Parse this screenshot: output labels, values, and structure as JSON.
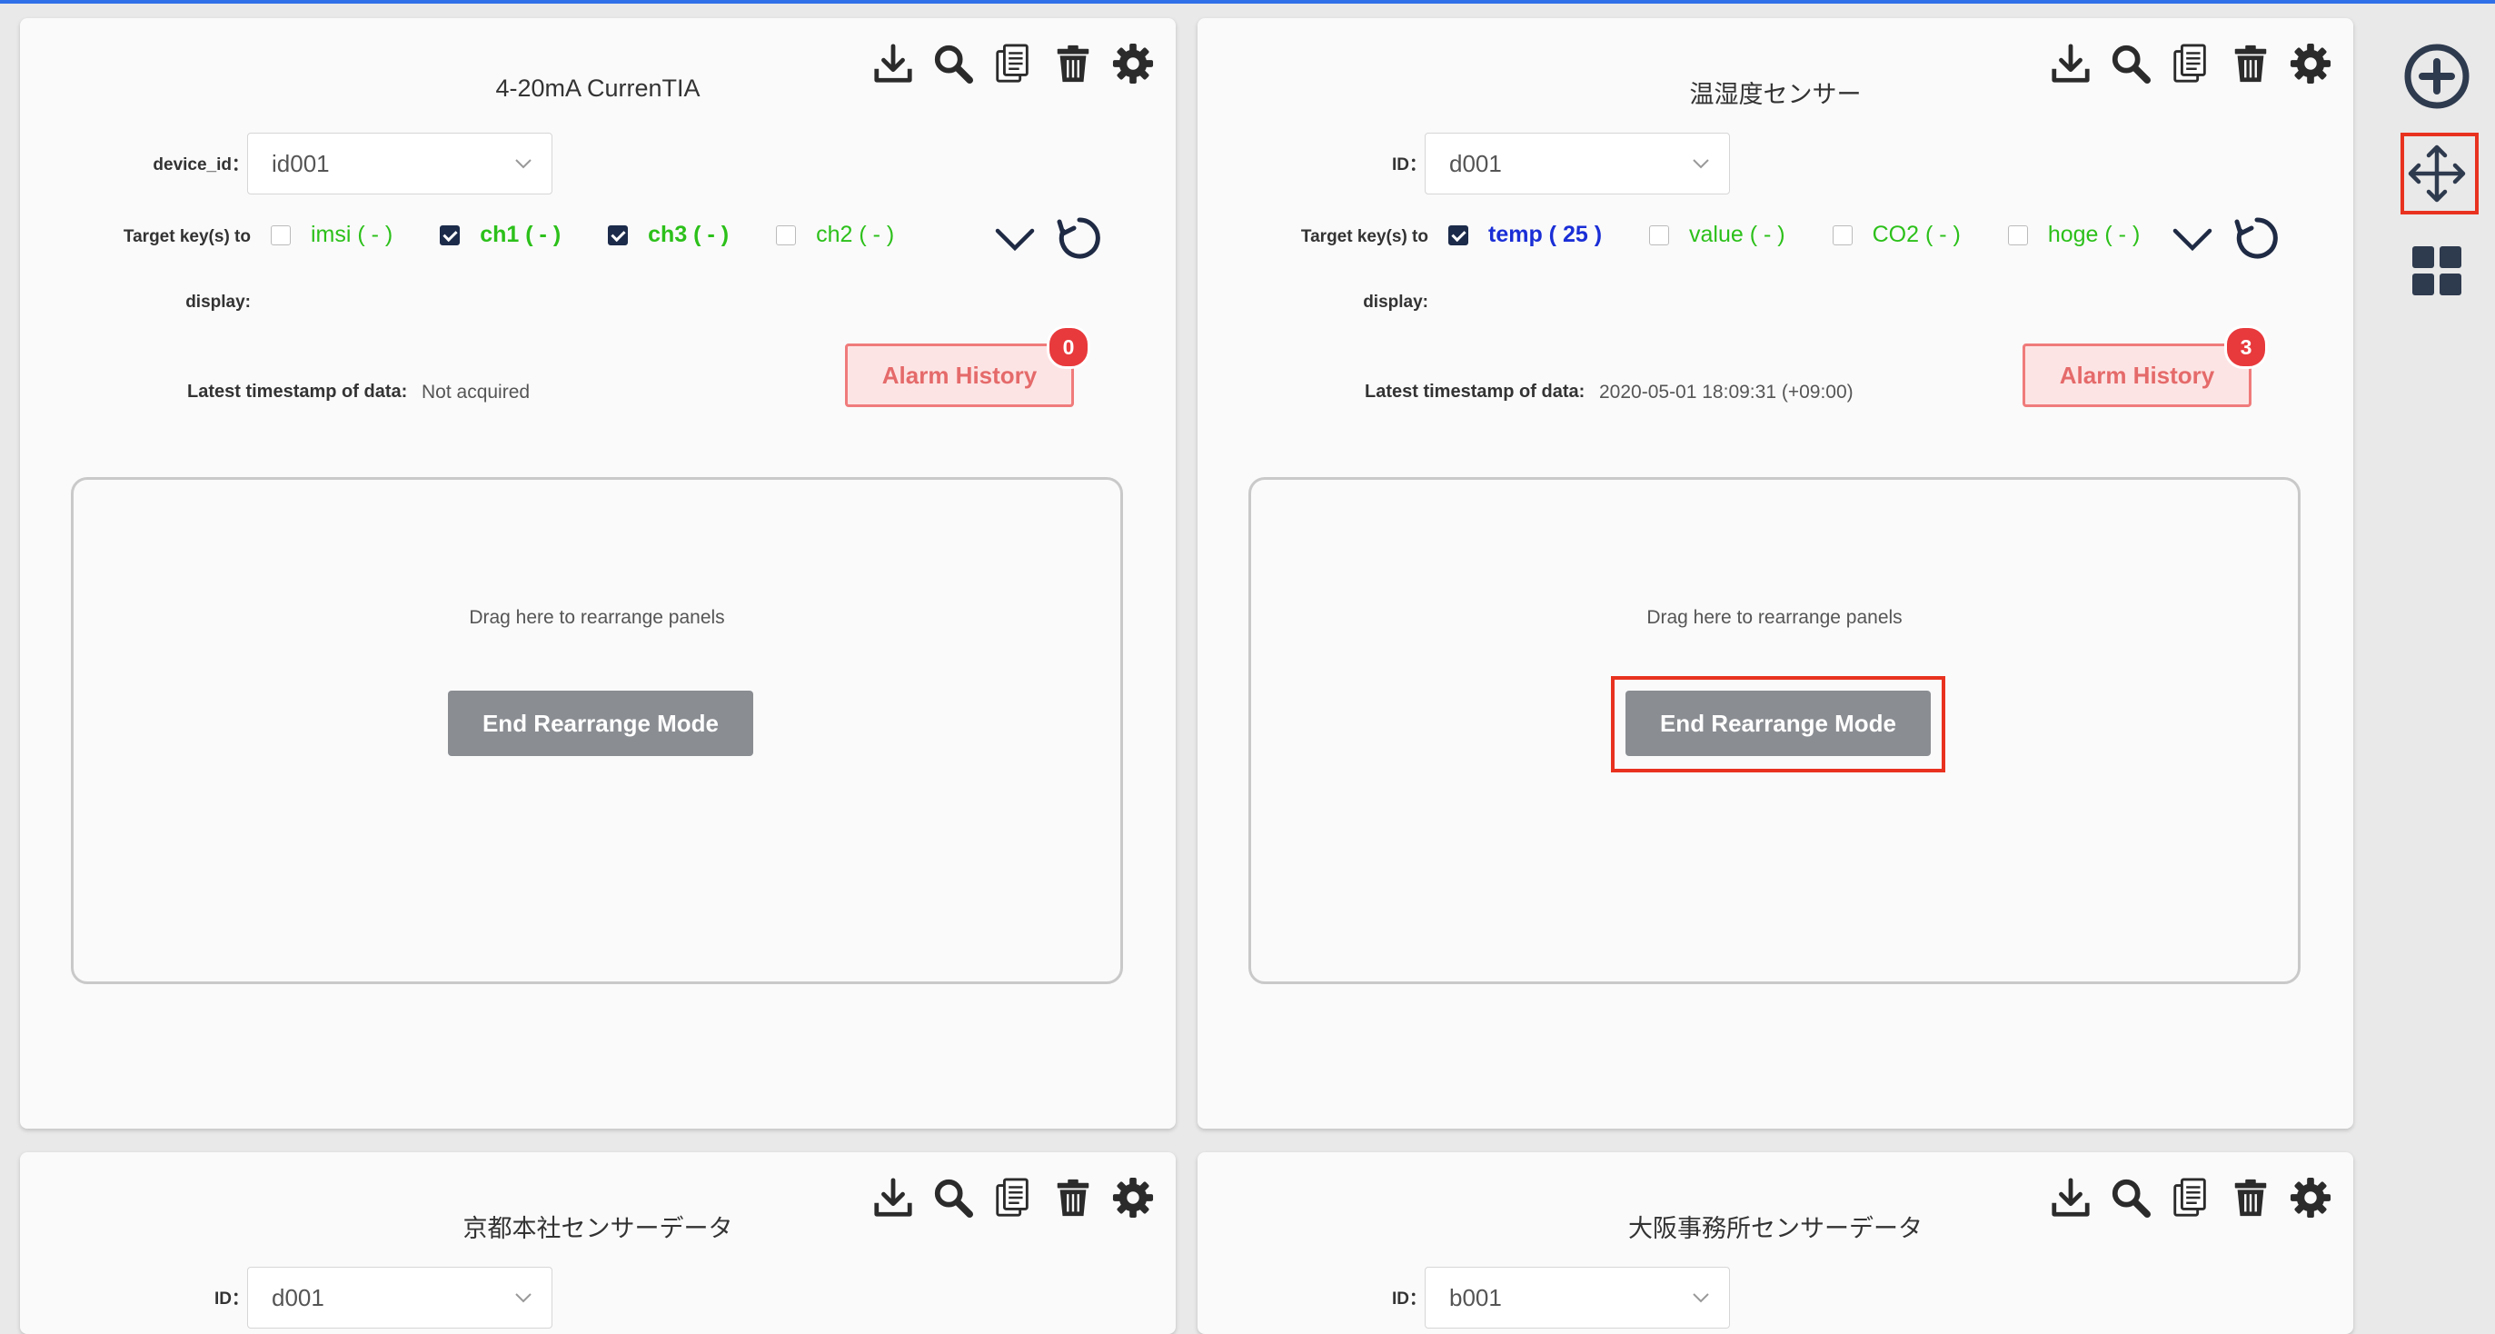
{
  "panels": [
    {
      "title": "4-20mA CurrenTIA",
      "id_label": "device_id：",
      "id_value": "id001",
      "target_label_line1": "Target key(s) to",
      "target_label_line2": "display:",
      "keys": [
        {
          "label": "imsi ( - )",
          "checked": false
        },
        {
          "label": "ch1 ( - )",
          "checked": true
        },
        {
          "label": "ch3 ( - )",
          "checked": true
        },
        {
          "label": "ch2 ( - )",
          "checked": false
        }
      ],
      "timestamp_label": "Latest timestamp of data:",
      "timestamp_value": "Not acquired",
      "alarm_label": "Alarm History",
      "alarm_count": "0",
      "drag_text": "Drag here to rearrange panels",
      "end_button": "End Rearrange Mode"
    },
    {
      "title": "温湿度センサー",
      "id_label": "ID：",
      "id_value": "d001",
      "target_label_line1": "Target key(s) to",
      "target_label_line2": "display:",
      "keys": [
        {
          "label": "temp ( 25 )",
          "checked": true
        },
        {
          "label": "value ( - )",
          "checked": false
        },
        {
          "label": "CO2 ( - )",
          "checked": false
        },
        {
          "label": "hoge ( - )",
          "checked": false
        }
      ],
      "timestamp_label": "Latest timestamp of data:",
      "timestamp_value": "2020-05-01 18:09:31 (+09:00)",
      "alarm_label": "Alarm History",
      "alarm_count": "3",
      "drag_text": "Drag here to rearrange panels",
      "end_button": "End Rearrange Mode"
    },
    {
      "title": "京都本社センサーデータ",
      "id_label": "ID：",
      "id_value": "d001"
    },
    {
      "title": "大阪事務所センサーデータ",
      "id_label": "ID：",
      "id_value": "b001"
    }
  ],
  "toolbar_icons": [
    "download-icon",
    "search-icon",
    "copy-icon",
    "trash-icon",
    "gear-icon"
  ],
  "sidebar_icons": [
    "add-circle-icon",
    "move-arrows-icon",
    "grid-icon"
  ],
  "colors": {
    "key_green": "#2cc01a",
    "key_blue": "#1a2ed6",
    "alarm_border": "#f07b7b",
    "badge": "#e8393c",
    "highlight": "#e8321f",
    "end_button": "#8a8d92",
    "top_line": "#2f6fe8"
  }
}
